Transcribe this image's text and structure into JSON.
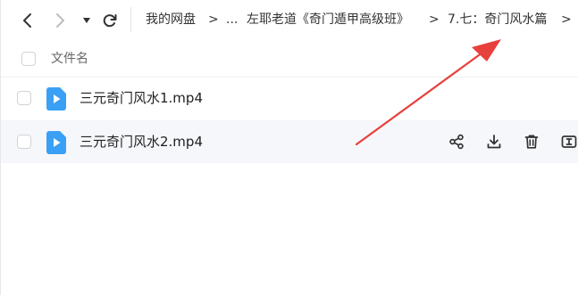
{
  "nav": {
    "icons": [
      "back-arrow-icon",
      "forward-arrow-icon",
      "dropdown-caret-icon",
      "refresh-icon"
    ]
  },
  "breadcrumb": {
    "items": [
      "我的网盘",
      "...",
      "左耶老道《奇门遁甲高级班》",
      "7.七：奇门风水篇"
    ],
    "separator": ">"
  },
  "table": {
    "column_header": "文件名"
  },
  "files": [
    {
      "name": "三元奇门风水1.mp4",
      "icon": "video-file-icon"
    },
    {
      "name": "三元奇门风水2.mp4",
      "icon": "video-file-icon"
    }
  ],
  "row_actions": [
    "share-icon",
    "download-icon",
    "delete-icon",
    "rename-icon"
  ],
  "colors": {
    "file_icon": "#3aa0f5",
    "annotation_arrow": "#e8403c",
    "hover_row": "#f6f7fa"
  }
}
